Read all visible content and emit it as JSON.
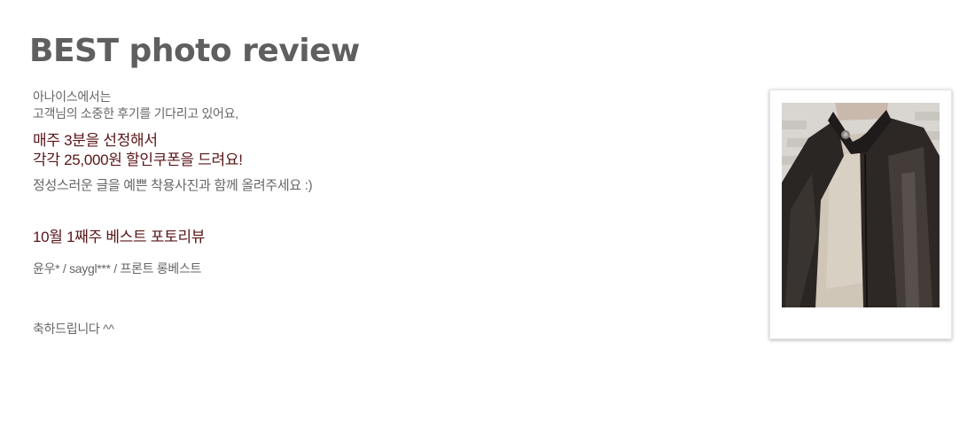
{
  "header": {
    "title": "BEST photo review"
  },
  "intro": {
    "line1": "아나이스에서는",
    "line2": "고객님의 소중한 후기를 기다리고 있어요,"
  },
  "highlight": {
    "line1": "매주 3분을 선정해서",
    "line2": "각각 25,000원 할인쿠폰을 드려요!"
  },
  "guide": "정성스러운 글을 예쁜 착용사진과 함께 올려주세요 :)",
  "week": {
    "title": "10월 1째주 베스트 포토리뷰",
    "winners": "윤우* / saygl*** / 프론트 롱베스트"
  },
  "congrats": "축하드립니다 ^^",
  "photo": {
    "subject": "leather-jacket-review-photo"
  },
  "colors": {
    "title": "#5f5f5f",
    "accent": "#5a1518",
    "body": "#666666"
  }
}
